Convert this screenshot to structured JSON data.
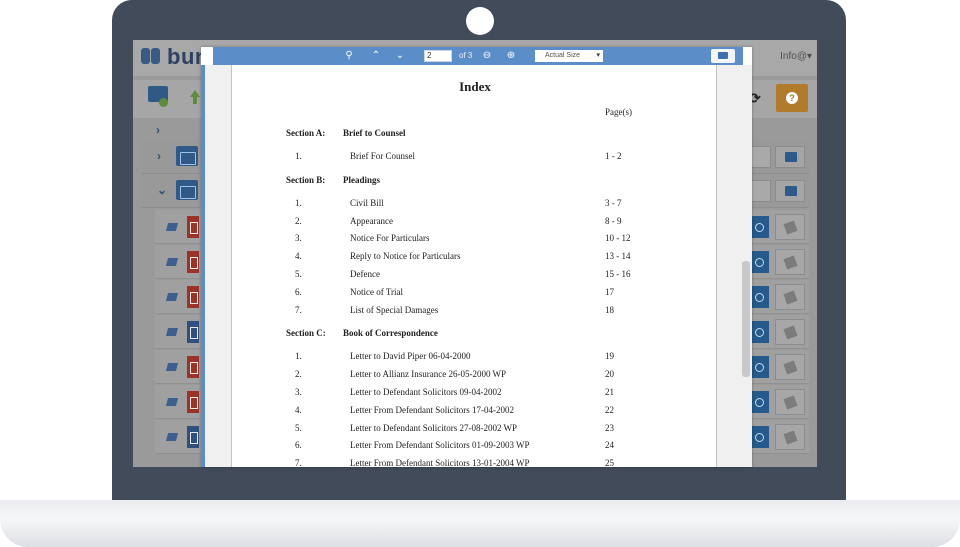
{
  "app": {
    "logo_text": "bun",
    "user_menu": "Info@▾"
  },
  "toolbar": {
    "refresh_icon": "refresh-icon",
    "help_icon": "help-icon",
    "help_glyph": "?"
  },
  "tree": {
    "collapsed_chevron": "›",
    "expanded_chevron": "⌄"
  },
  "viewer": {
    "search_icon": "search-icon",
    "prev_glyph": "⌃",
    "next_glyph": "⌄",
    "page_current": "2",
    "page_of": "of 3",
    "zoom_out_glyph": "⊖",
    "zoom_in_glyph": "⊕",
    "zoom_select": "Actual Size",
    "print_icon": "print-icon"
  },
  "document": {
    "title": "Index",
    "pages_header": "Page(s)",
    "sections": [
      {
        "label": "Section A:",
        "name": "Brief to Counsel",
        "items": [
          {
            "num": "1.",
            "name": "Brief For Counsel",
            "pages": "1 - 2"
          }
        ]
      },
      {
        "label": "Section B:",
        "name": "Pleadings",
        "items": [
          {
            "num": "1.",
            "name": "Civil Bill",
            "pages": "3 - 7"
          },
          {
            "num": "2.",
            "name": "Appearance",
            "pages": "8 - 9"
          },
          {
            "num": "3.",
            "name": "Notice For Particulars",
            "pages": "10 - 12"
          },
          {
            "num": "4.",
            "name": "Reply to Notice for Particulars",
            "pages": "13 - 14"
          },
          {
            "num": "5.",
            "name": "Defence",
            "pages": "15 - 16"
          },
          {
            "num": "6.",
            "name": "Notice of Trial",
            "pages": "17"
          },
          {
            "num": "7.",
            "name": "List of Special Damages",
            "pages": "18"
          }
        ]
      },
      {
        "label": "Section C:",
        "name": "Book of Correspondence",
        "items": [
          {
            "num": "1.",
            "name": "Letter to David Piper 06-04-2000",
            "pages": "19"
          },
          {
            "num": "2.",
            "name": "Letter to Allianz Insurance 26-05-2000 WP",
            "pages": "20"
          },
          {
            "num": "3.",
            "name": "Letter to Defendant Solicitors 09-04-2002",
            "pages": "21"
          },
          {
            "num": "4.",
            "name": "Letter From Defendant Solicitors 17-04-2002",
            "pages": "22"
          },
          {
            "num": "5.",
            "name": "Letter to Defendant Solicitors 27-08-2002 WP",
            "pages": "23"
          },
          {
            "num": "6.",
            "name": "Letter From Defendant Solicitors 01-09-2003 WP",
            "pages": "24"
          },
          {
            "num": "7.",
            "name": "Letter From Defendant Solicitors 13-01-2004 WP",
            "pages": "25"
          }
        ]
      }
    ]
  },
  "colors": {
    "laptop_bezel": "#414b59",
    "viewer_bar": "#5b8ec9",
    "help_button": "#b07c2c",
    "folder_blue": "#2f5a88"
  }
}
